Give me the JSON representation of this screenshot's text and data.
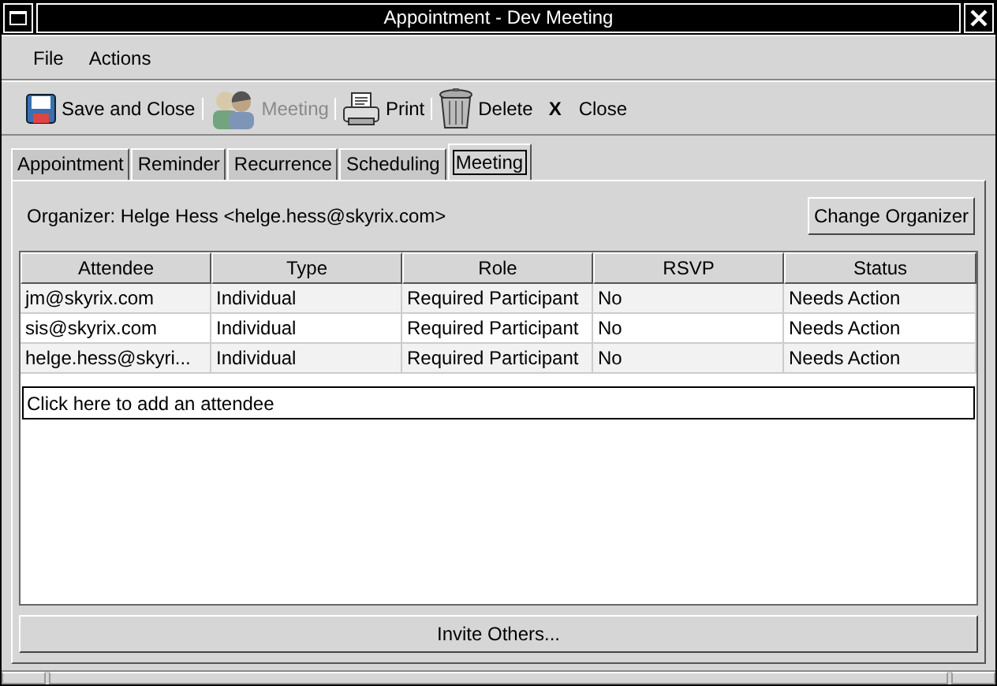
{
  "window": {
    "title": "Appointment - Dev Meeting"
  },
  "menu": [
    "File",
    "Actions"
  ],
  "toolbar": [
    {
      "kind": "save",
      "label": "Save and Close",
      "disabled": false
    },
    {
      "kind": "meeting",
      "label": "Meeting",
      "disabled": true
    },
    {
      "kind": "print",
      "label": "Print",
      "disabled": false
    },
    {
      "kind": "delete",
      "label": "Delete",
      "disabled": false
    },
    {
      "kind": "close",
      "label": "Close",
      "icon": "X",
      "disabled": false
    }
  ],
  "tabs": [
    {
      "label": "Appointment",
      "selected": false
    },
    {
      "label": "Reminder",
      "selected": false
    },
    {
      "label": "Recurrence",
      "selected": false
    },
    {
      "label": "Scheduling",
      "selected": false
    },
    {
      "label": "Meeting",
      "selected": true
    }
  ],
  "organizer": "Organizer: Helge Hess <helge.hess@skyrix.com>",
  "change_button": "Change Organizer",
  "table": {
    "columns": [
      "Attendee",
      "Type",
      "Role",
      "RSVP",
      "Status"
    ],
    "rows": [
      [
        "jm@skyrix.com",
        "Individual",
        "Required Participant",
        "No",
        "Needs Action"
      ],
      [
        "sis@skyrix.com",
        "Individual",
        "Required Participant",
        "No",
        "Needs Action"
      ],
      [
        "helge.hess@skyri...",
        "Individual",
        "Required Participant",
        "No",
        "Needs Action"
      ]
    ]
  },
  "add_field": {
    "value": "Click here to add an attendee"
  },
  "invite_button": "Invite Others..."
}
